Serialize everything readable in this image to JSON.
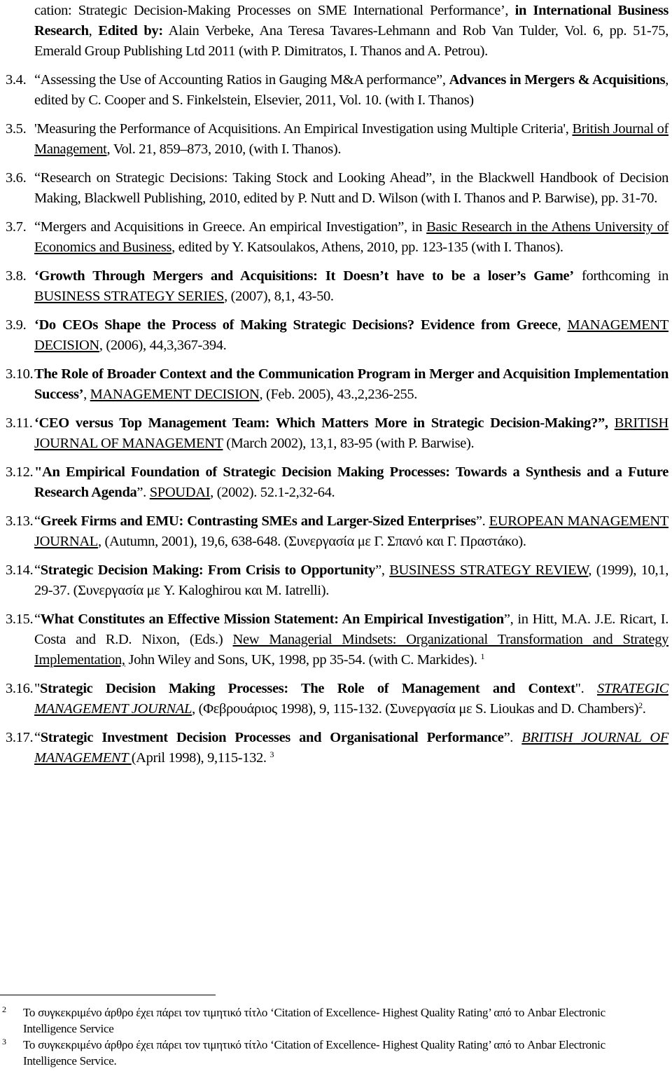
{
  "entries": [
    {
      "number": "",
      "parts": [
        {
          "t": "cation: Strategic Decision-Making Processes on SME International Performance’, ",
          "s": ""
        },
        {
          "t": "in International Business Research",
          "s": "b"
        },
        {
          "t": ", ",
          "s": ""
        },
        {
          "t": "Edited by:",
          "s": "b"
        },
        {
          "t": " Alain Verbeke, Ana Teresa Tavares-Lehmann and Rob Van Tulder, Vol. 6, pp. 51-75, Emerald Group Publishing Ltd 2011 (with  P. Dimitratos, I. Thanos and A. Petrou).",
          "s": ""
        }
      ]
    },
    {
      "number": "3.4.",
      "parts": [
        {
          "t": "“Assessing the Use of Accounting Ratios in Gauging M&A performance”, ",
          "s": ""
        },
        {
          "t": "Advances in Mergers & Acquisitions",
          "s": "b"
        },
        {
          "t": ", edited by C. Cooper and S. Finkelstein, Elsevier, 2011, Vol. 10. (with I. Thanos)",
          "s": ""
        }
      ]
    },
    {
      "number": "3.5.",
      "parts": [
        {
          "t": "'Measuring the Performance of Acquisitions. An Empirical Investigation using Multiple Criteria',  ",
          "s": ""
        },
        {
          "t": "British Journal of Management",
          "s": "u"
        },
        {
          "t": ", Vol. 21, 859–873, 2010,  (with I. Thanos).",
          "s": ""
        }
      ]
    },
    {
      "number": "3.6.",
      "parts": [
        {
          "t": "“Research on Strategic Decisions: Taking Stock and Looking Ahead”, in the Blackwell Handbook of Decision Making, Blackwell Publishing, 2010, edited by P. Nutt and D. Wilson (with I. Thanos and P. Barwise), pp. 31-70.",
          "s": ""
        }
      ]
    },
    {
      "number": "3.7.",
      "parts": [
        {
          "t": "“Mergers and Acquisitions in Greece. An empirical Investigation”, in  ",
          "s": ""
        },
        {
          "t": "Basic Research in the Athens University of Economics and Business",
          "s": "u"
        },
        {
          "t": ", edited by Y. Katsoulakos, Athens, 2010, pp. 123-135 (with I. Thanos).",
          "s": ""
        }
      ]
    },
    {
      "number": "3.8.",
      "parts": [
        {
          "t": "‘Growth Through Mergers and Acquisitions: It Doesn’t have to be a loser’s Game’",
          "s": "b"
        },
        {
          "t": " forthcoming in  ",
          "s": ""
        },
        {
          "t": "BUSINESS STRATEGY SERIES",
          "s": "u"
        },
        {
          "t": ", (2007), 8,1, 43-50.",
          "s": ""
        }
      ]
    },
    {
      "number": "3.9.",
      "parts": [
        {
          "t": " ‘Do CEOs Shape the Process of Making Strategic Decisions? Evidence from Greece",
          "s": "b"
        },
        {
          "t": ", ",
          "s": ""
        },
        {
          "t": "MANAGEMENT DECISION",
          "s": "u"
        },
        {
          "t": ", (2006), 44,3,367-394.",
          "s": ""
        }
      ]
    },
    {
      "number": "3.10.",
      "parts": [
        {
          "t": "The Role of Broader Context and the Communication Program in Merger and Acquisition Implementation Success’",
          "s": "b"
        },
        {
          "t": ", ",
          "s": ""
        },
        {
          "t": "MANAGEMENT DECISION",
          "s": "u"
        },
        {
          "t": ", (Feb. 2005), 43.,2,236-255.",
          "s": ""
        }
      ]
    },
    {
      "number": "3.11.",
      "parts": [
        {
          "t": "‘CEO versus Top Management Team: Which Matters More in Strategic Decision-Making?”,",
          "s": "b"
        },
        {
          "t": " ",
          "s": ""
        },
        {
          "t": "BRITISH JOURNAL OF MANAGEMENT",
          "s": "u"
        },
        {
          "t": " (March 2002), 13,1, 83-95 (with P. Barwise).",
          "s": ""
        }
      ]
    },
    {
      "number": "3.12.",
      "parts": [
        {
          "t": "\"An Empirical Foundation of Strategic Decision Making Processes: Towards a Synthesis and a Future Research Agenda",
          "s": "b"
        },
        {
          "t": "”. ",
          "s": ""
        },
        {
          "t": "SPOUDAI",
          "s": "u"
        },
        {
          "t": ", (2002). 52.1-2,32-64.",
          "s": ""
        }
      ]
    },
    {
      "number": "3.13.",
      "parts": [
        {
          "t": "“",
          "s": ""
        },
        {
          "t": "Greek Firms and EMU: Contrasting SMEs and Larger-Sized Enterprises",
          "s": "b"
        },
        {
          "t": "”. ",
          "s": ""
        },
        {
          "t": "EUROPEAN MANAGEMENT JOURNAL",
          "s": "u"
        },
        {
          "t": ", (Autumn, 2001), 19,6, 638-648. (Συνεργασία με Γ. Σπανό και Γ. Πραστάκο).",
          "s": ""
        }
      ]
    },
    {
      "number": "3.14.",
      "parts": [
        {
          "t": "“",
          "s": ""
        },
        {
          "t": "Strategic Decision Making: From Crisis to Opportunity",
          "s": "b"
        },
        {
          "t": "”, ",
          "s": ""
        },
        {
          "t": "BUSINESS STRATEGY REVIEW",
          "s": "u"
        },
        {
          "t": ", (1999), 10,1, 29-37. (Συνεργασία με Y. Kaloghirou και M. Iatrelli).",
          "s": ""
        }
      ]
    },
    {
      "number": "3.15.",
      "parts": [
        {
          "t": "“",
          "s": ""
        },
        {
          "t": "What Constitutes an Effective Mission Statement: An Empirical Investigation",
          "s": "b"
        },
        {
          "t": "”, in Hitt, M.A. J.E. Ricart, I. Costa and R.D. Nixon, (Eds.) ",
          "s": ""
        },
        {
          "t": "New Managerial Mindsets: Organizational Transformation and Strategy Implementation,",
          "s": "u"
        },
        {
          "t": "  John Wiley and Sons, UK, 1998, pp 35-54. (with C. Markides). ",
          "s": ""
        },
        {
          "t": "1",
          "s": "sup"
        }
      ]
    },
    {
      "number": "3.16.",
      "parts": [
        {
          "t": "\"",
          "s": ""
        },
        {
          "t": "Strategic Decision Making Processes: The Role of Management and Context",
          "s": "b"
        },
        {
          "t": "\". ",
          "s": ""
        },
        {
          "t": "STRATEGIC MANAGEMENT JOURNAL",
          "s": "ui"
        },
        {
          "t": ", (Φεβρουάριος 1998), 9, 115-132. (Συνεργασία με S. Lioukas and D. Chambers)",
          "s": ""
        },
        {
          "t": "2",
          "s": "sup"
        },
        {
          "t": ".",
          "s": ""
        }
      ]
    },
    {
      "number": "3.17.",
      "parts": [
        {
          "t": "“",
          "s": ""
        },
        {
          "t": "Strategic Investment Decision Processes and Organisational Performance",
          "s": "b"
        },
        {
          "t": "”. ",
          "s": ""
        },
        {
          "t": "BRITISH JOURNAL OF MANAGEMENT ",
          "s": "ui"
        },
        {
          "t": " (April 1998), 9,115-132. ",
          "s": ""
        },
        {
          "t": "3",
          "s": "sup"
        }
      ]
    }
  ],
  "footnotes": [
    {
      "number": "2",
      "text": "Το συγκεκριμένο άρθρο έχει πάρει τον τιμητικό τίτλο ‘Citation of Excellence- Highest Quality Rating’ από το Anbar Electronic Intelligence Service"
    },
    {
      "number": "3",
      "text": "Το συγκεκριμένο άρθρο έχει πάρει τον τιμητικό τίτλο ‘Citation of Excellence- Highest Quality Rating’ από το Anbar Electronic Intelligence Service."
    }
  ]
}
